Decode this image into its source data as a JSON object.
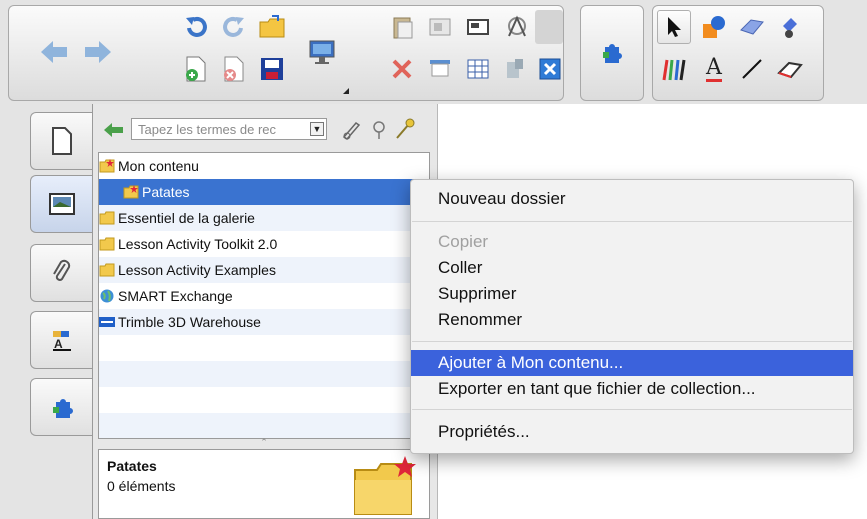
{
  "toolbar": {
    "buttons": [
      {
        "icon": "back-arrow-icon"
      },
      {
        "icon": "forward-arrow-icon"
      },
      {
        "icon": "undo-icon"
      },
      {
        "icon": "redo-icon"
      },
      {
        "icon": "open-file-icon"
      },
      {
        "icon": "add-page-icon"
      },
      {
        "icon": "delete-page-icon"
      },
      {
        "icon": "save-icon"
      },
      {
        "icon": "screen-share-icon"
      },
      {
        "icon": "paste-icon"
      },
      {
        "icon": "screen-capture-icon"
      },
      {
        "icon": "full-screen-icon"
      },
      {
        "icon": "measure-tools-icon"
      },
      {
        "icon": "delete-icon"
      },
      {
        "icon": "screen-shade-icon"
      },
      {
        "icon": "table-icon"
      },
      {
        "icon": "properties-icon"
      },
      {
        "icon": "close-box-icon"
      },
      {
        "icon": "addon-puzzle-icon"
      },
      {
        "icon": "select-arrow-icon"
      },
      {
        "icon": "shapes-icon"
      },
      {
        "icon": "eraser-shape-icon"
      },
      {
        "icon": "fill-icon"
      },
      {
        "icon": "pens-icon"
      },
      {
        "icon": "text-icon"
      },
      {
        "icon": "line-icon"
      },
      {
        "icon": "eraser-icon"
      }
    ],
    "text_label": "A"
  },
  "sidetabs": [
    {
      "name": "page-sorter",
      "icon": "page-icon"
    },
    {
      "name": "gallery",
      "icon": "gallery-image-icon"
    },
    {
      "name": "attachments",
      "icon": "paperclip-icon"
    },
    {
      "name": "properties",
      "icon": "properties-icon"
    },
    {
      "name": "addons",
      "icon": "puzzle-icon"
    }
  ],
  "gallery": {
    "search_placeholder": "Tapez les termes de rec",
    "search_dropdown": "▼",
    "tree": [
      {
        "label": "Mon contenu",
        "icon": "folder-star-icon",
        "indent": 0
      },
      {
        "label": "Patates",
        "icon": "folder-star-icon",
        "indent": 1,
        "selected": true
      },
      {
        "label": "Essentiel de la galerie",
        "icon": "folder-icon",
        "indent": 0
      },
      {
        "label": "Lesson Activity Toolkit 2.0",
        "icon": "folder-icon",
        "indent": 0
      },
      {
        "label": "Lesson Activity Examples",
        "icon": "folder-icon",
        "indent": 0
      },
      {
        "label": "SMART Exchange",
        "icon": "globe-icon",
        "indent": 0
      },
      {
        "label": "Trimble 3D Warehouse",
        "icon": "smart-logo-icon",
        "indent": 0
      }
    ],
    "row_dropdown": "▼",
    "details": {
      "name": "Patates",
      "count": "0 éléments",
      "icon": "folder-star-icon"
    }
  },
  "context_menu": {
    "items": [
      {
        "label": "Nouveau dossier",
        "state": "normal"
      },
      {
        "label": "Copier",
        "state": "disabled"
      },
      {
        "label": "Coller",
        "state": "normal"
      },
      {
        "label": "Supprimer",
        "state": "normal"
      },
      {
        "label": "Renommer",
        "state": "normal"
      },
      {
        "label": "Ajouter à Mon contenu...",
        "state": "highlighted"
      },
      {
        "label": "Exporter en tant que fichier de collection...",
        "state": "normal"
      },
      {
        "label": "Propriétés...",
        "state": "normal"
      }
    ]
  },
  "colors": {
    "selection": "#3a73d0",
    "menu_highlight": "#3b62dc",
    "folder": "#f2c94c",
    "star": "#e0263a"
  }
}
